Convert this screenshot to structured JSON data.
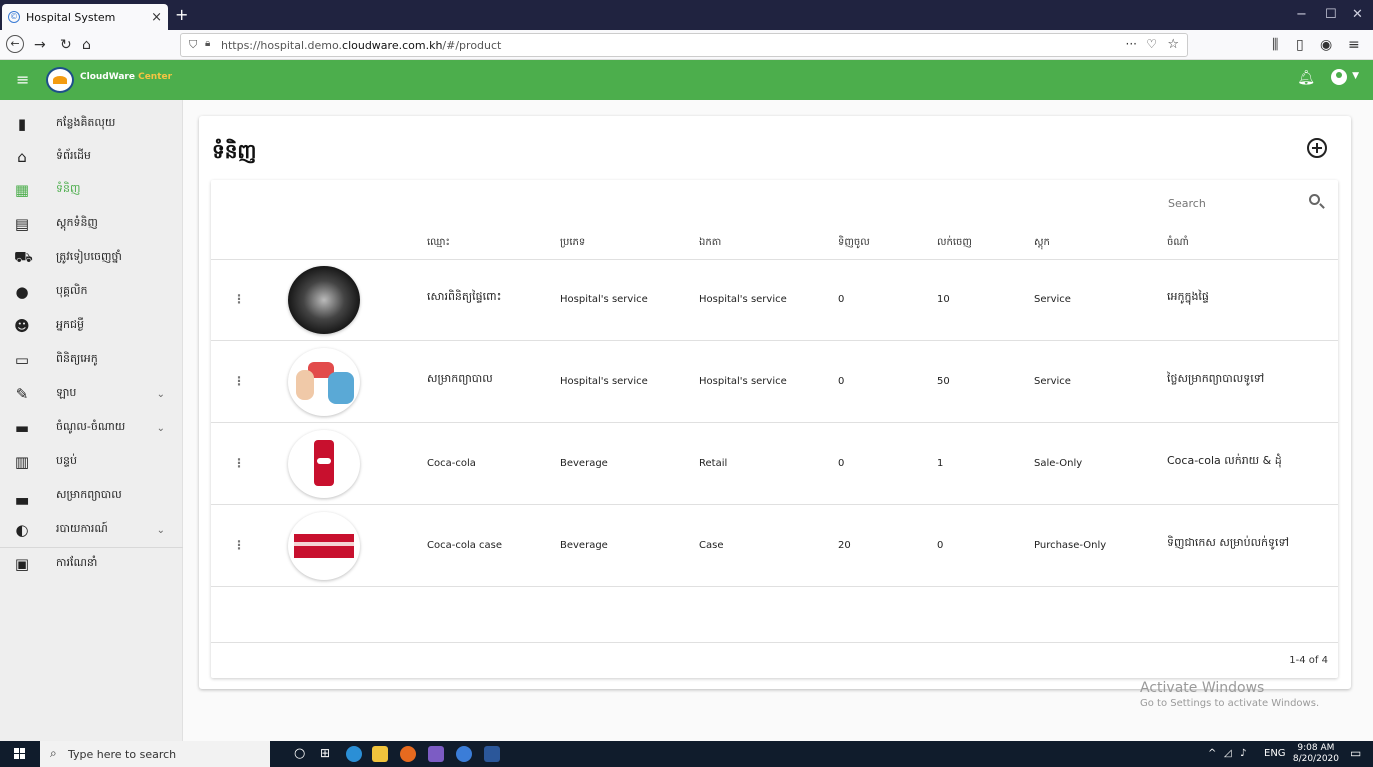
{
  "browser": {
    "tab_title": "Hospital System",
    "tab_close": "×",
    "new_tab": "+",
    "url_prefix": "https://hospital.demo.",
    "url_domain": "cloudware.com.kh",
    "url_suffix": "/#/product",
    "page_actions": "···",
    "window_controls": [
      "−",
      "☐",
      "✕"
    ]
  },
  "app": {
    "logo_text_1": "CloudWare",
    "logo_text_2": "Center",
    "accent_color": "#4cae4c"
  },
  "sidebar": {
    "items": [
      {
        "label": "កន្លែងគិតលុយ",
        "icon": "cash-register-icon",
        "glyph": "▮"
      },
      {
        "label": "ទំព័រដើម",
        "icon": "home-icon",
        "glyph": "⌂"
      },
      {
        "label": "ទំនិញ",
        "icon": "boxes-icon",
        "glyph": "▦",
        "active": true
      },
      {
        "label": "ស្តុកទំនិញ",
        "icon": "warehouse-icon",
        "glyph": "▤"
      },
      {
        "label": "ត្រូវទៀបចេញថ្នាំ",
        "icon": "cart-icon",
        "glyph": "⛟"
      },
      {
        "label": "បុគ្គលិក",
        "icon": "staff-icon",
        "glyph": "●"
      },
      {
        "label": "អ្នកជម្ងឺ",
        "icon": "patient-icon",
        "glyph": "☻"
      },
      {
        "label": "ពិនិត្យអេកូ",
        "icon": "monitor-icon",
        "glyph": "▭"
      },
      {
        "label": "ឡាប",
        "icon": "lab-icon",
        "glyph": "✎",
        "chevron": "⌄"
      },
      {
        "label": "ចំណូល-ចំណាយ",
        "icon": "wallet-icon",
        "glyph": "▬",
        "chevron": "⌄"
      },
      {
        "label": "បន្ទប់",
        "icon": "room-icon",
        "glyph": "▥"
      },
      {
        "label": "សម្រាកព្យាបាល",
        "icon": "bed-icon",
        "glyph": "▃"
      },
      {
        "label": "របាយការណ៍",
        "icon": "report-icon",
        "glyph": "◐",
        "chevron": "⌄"
      },
      {
        "label": "ការណែនាំ",
        "icon": "guide-icon",
        "glyph": "▣"
      }
    ]
  },
  "main": {
    "title": "ទំនិញ",
    "search_placeholder": "Search",
    "columns": [
      "ឈ្មោះ",
      "ប្រភេទ",
      "ឯកតា",
      "ទិញចូល",
      "លក់ចេញ",
      "ស្តុក",
      "ចំណាំ"
    ],
    "rows": [
      {
        "name": "សោរពិនិត្យផ្ទៃពោះ",
        "type": "Hospital's service",
        "unit": "Hospital's service",
        "buy": "0",
        "sell": "10",
        "stock": "Service",
        "note": "អេកូក្នុងផ្ទៃ",
        "image": "ultrasound-image"
      },
      {
        "name": "សម្រាកព្យាបាល",
        "type": "Hospital's service",
        "unit": "Hospital's service",
        "buy": "0",
        "sell": "50",
        "stock": "Service",
        "note": "ថ្លៃសម្រាកព្យាបាលទូទៅ",
        "image": "doctor-checkup-image"
      },
      {
        "name": "Coca-cola",
        "type": "Beverage",
        "unit": "Retail",
        "buy": "0",
        "sell": "1",
        "stock": "Sale-Only",
        "note": "Coca-cola លក់រាយ & ដុំ",
        "image": "coca-cola-can-image"
      },
      {
        "name": "Coca-cola case",
        "type": "Beverage",
        "unit": "Case",
        "buy": "20",
        "sell": "0",
        "stock": "Purchase-Only",
        "note": "ទិញជាកេស សម្រាប់លក់ទូទៅ",
        "image": "coca-cola-case-image"
      }
    ],
    "pagination": "1-4 of 4"
  },
  "watermark": {
    "line1": "Activate Windows",
    "line2": "Go to Settings to activate Windows."
  },
  "taskbar": {
    "search_placeholder": "Type here to search",
    "language": "ENG",
    "time": "9:08 AM",
    "date": "8/20/2020"
  }
}
